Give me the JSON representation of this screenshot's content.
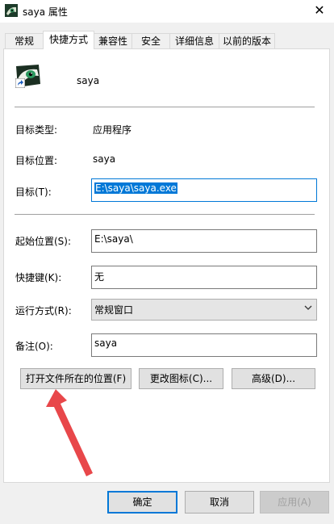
{
  "window": {
    "title": "saya 属性",
    "close_glyph": "✕"
  },
  "tabs": [
    {
      "label": "常规"
    },
    {
      "label": "快捷方式"
    },
    {
      "label": "兼容性"
    },
    {
      "label": "安全"
    },
    {
      "label": "详细信息"
    },
    {
      "label": "以前的版本"
    }
  ],
  "shortcut": {
    "name": "saya",
    "target_type_label": "目标类型:",
    "target_type_value": "应用程序",
    "target_location_label": "目标位置:",
    "target_location_value": "saya",
    "target_label": "目标(T):",
    "target_value": "E:\\saya\\saya.exe",
    "start_in_label": "起始位置(S):",
    "start_in_value": "E:\\saya\\",
    "hotkey_label": "快捷键(K):",
    "hotkey_value": "无",
    "run_label": "运行方式(R):",
    "run_value": "常规窗口",
    "comment_label": "备注(O):",
    "comment_value": "saya",
    "open_location_button": "打开文件所在的位置(F)",
    "change_icon_button": "更改图标(C)...",
    "advanced_button": "高级(D)..."
  },
  "footer": {
    "ok_button": "确定",
    "cancel_button": "取消",
    "apply_button": "应用(A)"
  },
  "colors": {
    "accent": "#0078d7",
    "annotation_arrow": "#e8474a"
  },
  "icons": {
    "app_icon": "anime-character-icon",
    "shortcut_overlay": "shortcut-arrow-icon"
  }
}
